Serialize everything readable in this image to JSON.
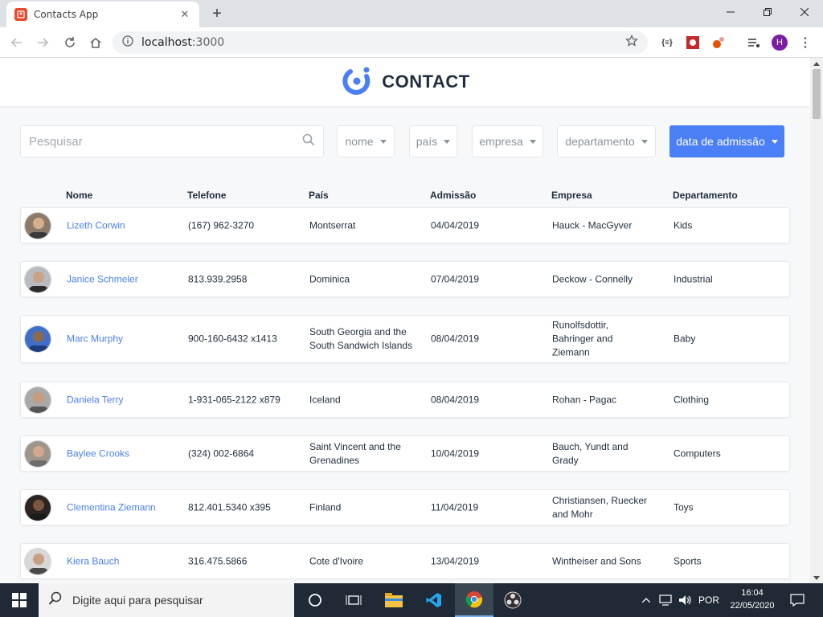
{
  "browser": {
    "tab_title": "Contacts App",
    "url_host": "localhost",
    "url_port": ":3000",
    "profile_initial": "H"
  },
  "app": {
    "logo_text": "CONTACT",
    "accent_color": "#4a7ff5"
  },
  "filters": {
    "search_placeholder": "Pesquisar",
    "name": "nome",
    "country": "país",
    "company": "empresa",
    "department": "departamento",
    "admission": "data de admissão"
  },
  "table": {
    "headers": {
      "name": "Nome",
      "phone": "Telefone",
      "country": "País",
      "admission": "Admissão",
      "company": "Empresa",
      "department": "Departamento"
    },
    "rows": [
      {
        "name": "Lizeth Corwin",
        "phone": "(167) 962-3270",
        "country": "Montserrat",
        "admission": "04/04/2019",
        "company": "Hauck - MacGyver",
        "department": "Kids"
      },
      {
        "name": "Janice Schmeler",
        "phone": "813.939.2958",
        "country": "Dominica",
        "admission": "07/04/2019",
        "company": "Deckow - Connelly",
        "department": "Industrial"
      },
      {
        "name": "Marc Murphy",
        "phone": "900-160-6432 x1413",
        "country": "South Georgia and the South Sandwich Islands",
        "admission": "08/04/2019",
        "company": "Runolfsdottir, Bahringer and Ziemann",
        "department": "Baby"
      },
      {
        "name": "Daniela Terry",
        "phone": "1-931-065-2122 x879",
        "country": "Iceland",
        "admission": "08/04/2019",
        "company": "Rohan - Pagac",
        "department": "Clothing"
      },
      {
        "name": "Baylee Crooks",
        "phone": "(324) 002-6864",
        "country": "Saint Vincent and the Grenadines",
        "admission": "10/04/2019",
        "company": "Bauch, Yundt and Grady",
        "department": "Computers"
      },
      {
        "name": "Clementina Ziemann",
        "phone": "812.401.5340 x395",
        "country": "Finland",
        "admission": "11/04/2019",
        "company": "Christiansen, Ruecker and Mohr",
        "department": "Toys"
      },
      {
        "name": "Kiera Bauch",
        "phone": "316.475.5866",
        "country": "Cote d'Ivoire",
        "admission": "13/04/2019",
        "company": "Wintheiser and Sons",
        "department": "Sports"
      }
    ]
  },
  "taskbar": {
    "search_placeholder": "Digite aqui para pesquisar",
    "language": "POR",
    "time": "16:04",
    "date": "22/05/2020"
  }
}
